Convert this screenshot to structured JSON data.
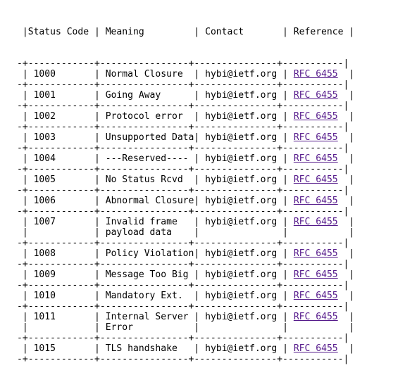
{
  "header": {
    "status_code": "Status Code",
    "meaning": "Meaning",
    "contact": "Contact",
    "reference": "Reference"
  },
  "rows": [
    {
      "code": "1000",
      "meaning": [
        "Normal Closure"
      ],
      "contact": "hybi@ietf.org",
      "reference": "RFC 6455"
    },
    {
      "code": "1001",
      "meaning": [
        "Going Away"
      ],
      "contact": "hybi@ietf.org",
      "reference": "RFC 6455"
    },
    {
      "code": "1002",
      "meaning": [
        "Protocol error"
      ],
      "contact": "hybi@ietf.org",
      "reference": "RFC 6455"
    },
    {
      "code": "1003",
      "meaning": [
        "Unsupported Data"
      ],
      "contact": "hybi@ietf.org",
      "reference": "RFC 6455"
    },
    {
      "code": "1004",
      "meaning": [
        "---Reserved----"
      ],
      "contact": "hybi@ietf.org",
      "reference": "RFC 6455"
    },
    {
      "code": "1005",
      "meaning": [
        "No Status Rcvd"
      ],
      "contact": "hybi@ietf.org",
      "reference": "RFC 6455"
    },
    {
      "code": "1006",
      "meaning": [
        "Abnormal Closure"
      ],
      "contact": "hybi@ietf.org",
      "reference": "RFC 6455"
    },
    {
      "code": "1007",
      "meaning": [
        "Invalid frame",
        "payload data"
      ],
      "contact": "hybi@ietf.org",
      "reference": "RFC 6455"
    },
    {
      "code": "1008",
      "meaning": [
        "Policy Violation"
      ],
      "contact": "hybi@ietf.org",
      "reference": "RFC 6455"
    },
    {
      "code": "1009",
      "meaning": [
        "Message Too Big"
      ],
      "contact": "hybi@ietf.org",
      "reference": "RFC 6455"
    },
    {
      "code": "1010",
      "meaning": [
        "Mandatory Ext."
      ],
      "contact": "hybi@ietf.org",
      "reference": "RFC 6455"
    },
    {
      "code": "1011",
      "meaning": [
        "Internal Server",
        "Error"
      ],
      "contact": "hybi@ietf.org",
      "reference": "RFC 6455"
    },
    {
      "code": "1015",
      "meaning": [
        "TLS handshake"
      ],
      "contact": "hybi@ietf.org",
      "reference": "RFC 6455"
    }
  ],
  "colors": {
    "text": "#000000",
    "link": "#551a8b",
    "background": "#ffffff"
  }
}
